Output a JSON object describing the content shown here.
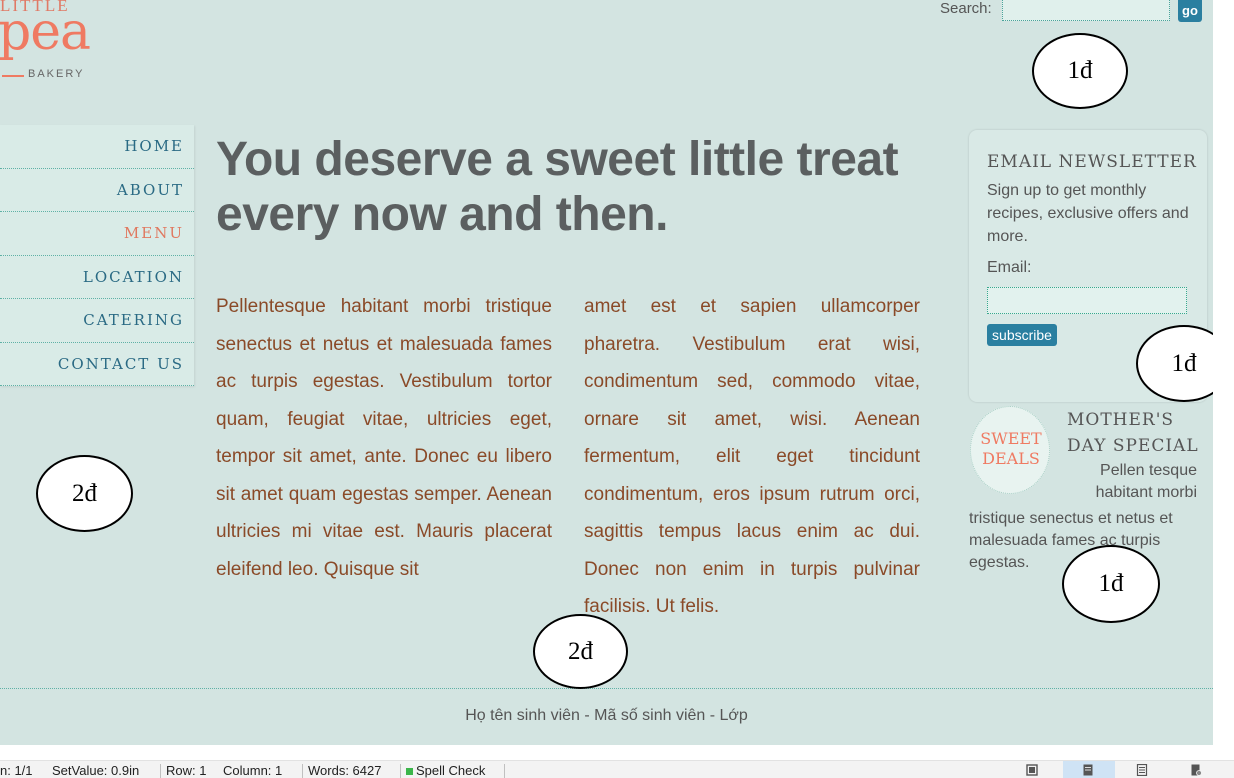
{
  "logo": {
    "little": "LITTLE",
    "pea": "pea",
    "bakery": "BAKERY"
  },
  "search": {
    "label": "Search:",
    "value": "",
    "button": "go"
  },
  "nav": {
    "items": [
      {
        "label": "HOME"
      },
      {
        "label": "ABOUT"
      },
      {
        "label": "MENU"
      },
      {
        "label": "LOCATION"
      },
      {
        "label": "CATERING"
      },
      {
        "label": "CONTACT US"
      }
    ],
    "active": "MENU"
  },
  "main": {
    "headline": "You deserve a sweet little treat every now and then.",
    "column1": "Pellentesque habitant morbi tristique senectus et netus et malesuada fames ac turpis egestas. Vestibulum tortor quam, feugiat vitae, ultricies eget, tempor sit amet, ante. Donec eu libero sit amet quam egestas semper. Aenean ultricies mi vitae est. Mauris placerat eleifend leo. Quisque sit",
    "column2": "amet est et sapien ullamcorper pharetra. Vestibulum erat wisi, condimentum sed, commodo vitae, ornare sit amet, wisi. Aenean fermentum, elit eget tincidunt condimentum, eros ipsum rutrum orci, sagittis tempus lacus enim ac dui. Donec non enim in turpis pulvinar facilisis. Ut felis."
  },
  "newsletter": {
    "title": "EMAIL NEWSLETTER",
    "description": "Sign up to get monthly recipes, exclusive offers and more.",
    "email_label": "Email:",
    "email_value": "",
    "subscribe": "subscribe"
  },
  "deals": {
    "badge_line1": "SWEET",
    "badge_line2": "DEALS",
    "title": "MOTHER'S DAY SPECIAL",
    "text_short": "Pellen tesque habitant morbi",
    "text_long": "tristique senectus et netus et malesuada fames ac turpis egestas."
  },
  "scores": {
    "search": "1đ",
    "newsletter": "1đ",
    "nav": "2đ",
    "deals": "1đ",
    "content": "2đ"
  },
  "footer": {
    "text": "Họ tên sinh viên - Mã số sinh viên - Lớp"
  },
  "statusbar": {
    "section": "n: 1/1",
    "setvalue": "SetValue: 0.9in",
    "row": "Row: 1",
    "column": "Column: 1",
    "words": "Words: 6427",
    "spell": "Spell Check"
  },
  "colors": {
    "background": "#d3e4e1",
    "nav_link": "#2a6a84",
    "active_link": "#e0785f",
    "body_text": "#8a4a28",
    "button": "#2a7fa0",
    "logo": "#ef7a62"
  }
}
